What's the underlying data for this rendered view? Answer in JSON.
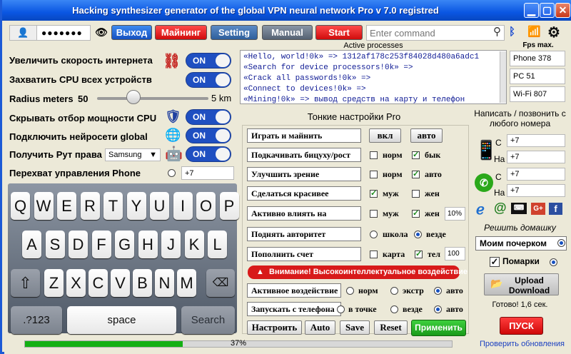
{
  "window": {
    "title": "Hacking synthesizer generator of the global VPN neural network Pro v 7.0 registred"
  },
  "toolbar": {
    "password": "●●●●●●●",
    "login": "Выход",
    "mining": "Майнинг",
    "setting": "Setting",
    "manual": "Manual",
    "start": "Start",
    "command_placeholder": "Enter command"
  },
  "left": {
    "rows": [
      "Увеличить скорость интернета",
      "Захватить CPU всех устройств",
      "Скрывать отбор мощности CPU",
      "Подключить нейросети global",
      "Получить Рут права",
      "Перехват управления Phone"
    ],
    "toggle_on": "ON",
    "radius_label": "Radius meters",
    "radius_value": "50",
    "radius_max": "5 km",
    "radius_fraction": 0.33,
    "root_select": "Samsung",
    "phone_value": "+7"
  },
  "console": {
    "label": "Active processes",
    "lines": [
      "«Hello, world!0k» => 1312af178c253f84028d480a6adc1",
      "«Search for device processors!0k» =>",
      "«Crack all passwords!0k» =>",
      "«Connect to devices!0k» =>",
      "«Mining!0k» => вывод средств на карту и телефон"
    ]
  },
  "fps": {
    "label": "Fps max.",
    "items": [
      "Phone 378",
      "PC 51",
      "Wi-Fi 807"
    ]
  },
  "fine": {
    "title": "Тонкие настройки Pro",
    "play": "Играть и майнить",
    "vkl": "вкл",
    "avto": "авто",
    "bicep": "Подкачивать бицуху/рост",
    "norm": "норм",
    "byk": "бык",
    "vision": "Улучшить зрение",
    "avto2": "авто",
    "beauty": "Сделаться красивее",
    "muzh": "муж",
    "zhen": "жен",
    "influence": "Активно влиять на",
    "pct": "10%",
    "authority": "Поднять авторитет",
    "school": "школа",
    "everywhere": "везде",
    "refill": "Пополнить счет",
    "card": "карта",
    "tel": "тел",
    "amount": "100",
    "warning": "Внимание! Высокоинтеллектуальное воздействие",
    "active": "Активное воздействие",
    "extr": "экстр",
    "launch": "Запускать с телефона",
    "point": "в точке",
    "setup": "Настроить",
    "auto": "Auto",
    "save": "Save",
    "reset": "Reset",
    "apply": "Применить"
  },
  "right": {
    "write": "Написать / позвонить с любого номера",
    "c": "С",
    "na": "На",
    "num": "+7",
    "homework": "Решить домашку",
    "handwriting": "Моим почерком",
    "blots": "Помарки",
    "upload": "Upload Download",
    "ready": "Готово! 1,6 сек.",
    "launch": "ПУСК",
    "updates": "Проверить обновления"
  },
  "keyboard": {
    "row1": [
      "Q",
      "W",
      "E",
      "R",
      "T",
      "Y",
      "U",
      "I",
      "O",
      "P"
    ],
    "row2": [
      "A",
      "S",
      "D",
      "F",
      "G",
      "H",
      "J",
      "K",
      "L"
    ],
    "row3": [
      "Z",
      "X",
      "C",
      "V",
      "B",
      "N",
      "M"
    ],
    "num": ".?123",
    "space": "space",
    "search": "Search"
  },
  "progress": {
    "label": "37%",
    "fraction": 0.37
  },
  "colors": {
    "title_bar": "#0a56e2",
    "accent_blue": "#1f4fc1",
    "accent_red": "#d00c0c",
    "apply_green": "#1a9a1a",
    "progress": "#14b014"
  }
}
